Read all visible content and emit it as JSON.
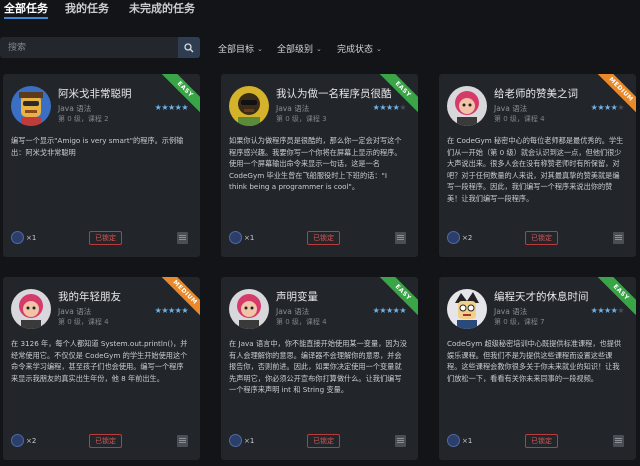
{
  "tabs": [
    {
      "label": "全部任务",
      "active": true
    },
    {
      "label": "我的任务",
      "active": false
    },
    {
      "label": "未完成的任务",
      "active": false
    }
  ],
  "search": {
    "placeholder": "搜索"
  },
  "filters": [
    {
      "label": "全部目标"
    },
    {
      "label": "全部级别"
    },
    {
      "label": "完成状态"
    }
  ],
  "colors": {
    "easy": "#3aa547",
    "medium": "#e9892a",
    "accent": "#3d8bd8",
    "locked": "#b83c3c"
  },
  "cards": [
    {
      "title": "阿米戈非常聪明",
      "language": "Java 语法",
      "meta": "第 0 级，课程 2",
      "difficulty": "EASY",
      "rating": 5,
      "description": "编写一个显示\"Amigo is very smart\"的程序。示例输出：阿米戈非常聪明",
      "count": "×1",
      "status": "已锁定"
    },
    {
      "title": "我认为做一名程序员很酷",
      "language": "Java 语法",
      "meta": "第 0 级，课程 3",
      "difficulty": "EASY",
      "rating": 4,
      "description": "如果你认为做程序员是很酷的，那么你一定会对写这个程序感兴趣。我要你写一个你将在屏幕上显示的程序。使用一个屏幕输出命令来显示一句话，这是一名 CodeGym 毕业生曾在飞船服役时上下班的话：\"I think being a programmer is cool\"。",
      "count": "×1",
      "status": "已锁定"
    },
    {
      "title": "给老师的赞美之词",
      "language": "Java 语法",
      "meta": "第 0 级，课程 4",
      "difficulty": "MEDIUM",
      "rating": 4,
      "description": "在 CodeGym 秘密中心的每位老师都是最优秀的。学生们从一开始（第 0 级）就会认识到这一点，但他们很少大声说出来。很多人会在没有称赞老师时有所保留，对吧？对于任何数量的人来说，对其最真挚的赞美就是编写一段程序。因此，我们编写一个程序来说出你的赞美！让我们编写一段程序。",
      "count": "×2",
      "status": "已锁定"
    },
    {
      "title": "我的年轻朋友",
      "language": "Java 语法",
      "meta": "第 0 级，课程 4",
      "difficulty": "MEDIUM",
      "rating": 5,
      "description": "在 3126 年，每个人都知道 System.out.println()，并经常使用它。不仅仅是 CodeGym 的学生开始使用这个命令来学习编程，甚至孩子们也会使用。编写一个程序来显示我朋友的真实出生年份，他 8 年前出生。",
      "count": "×2",
      "status": "已锁定"
    },
    {
      "title": "声明变量",
      "language": "Java 语法",
      "meta": "第 0 级，课程 4",
      "difficulty": "EASY",
      "rating": 5,
      "description": "在 Java 语言中，你不能直接开始使用某一变量，因为没有人会理解你的意思。编译器不会理解你的意思，并会报告你，否则前进。因此，如果你决定使用一个变量就先声明它，你必须公开宣布你打算做什么。让我们编写一个程序来声明 int 和 String 变量。",
      "count": "×1",
      "status": "已锁定"
    },
    {
      "title": "编程天才的休息时间",
      "language": "Java 语法",
      "meta": "第 0 级，课程 7",
      "difficulty": "EASY",
      "rating": 4,
      "description": "CodeGym 超级秘密培训中心既提供标准课程，也提供娱乐课程。但我们不是为提供这些课程而设置这些课程。这些课程会教你很多关于你未来就业的知识！让我们放松一下，看看有关你未来同事的一段视频。",
      "count": "×1",
      "status": "已锁定"
    }
  ]
}
